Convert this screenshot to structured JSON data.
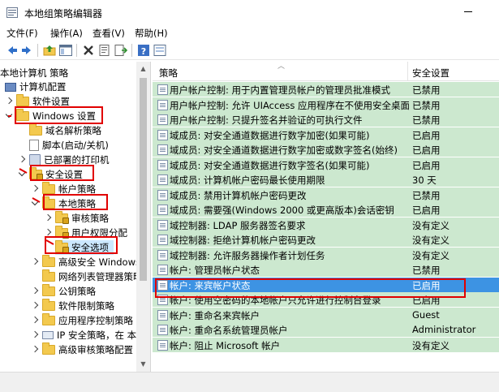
{
  "window": {
    "title": "本地组策略编辑器",
    "icons": {
      "app": "policy-editor-icon",
      "minimize": "minimize-icon"
    }
  },
  "menu": [
    "文件(F)",
    "操作(A)",
    "查看(V)",
    "帮助(H)"
  ],
  "toolbar": {
    "buttons": [
      "back-arrow-icon",
      "forward-arrow-icon",
      "up-folder-icon",
      "show-hide-tree-icon",
      "delete-icon",
      "properties-icon",
      "export-list-icon",
      "help-icon",
      "filter-view-icon"
    ]
  },
  "tree": {
    "root": "本地计算机 策略",
    "items": [
      {
        "label": "计算机配置"
      },
      {
        "label": "软件设置"
      },
      {
        "label": "Windows 设置"
      },
      {
        "label": "域名解析策略"
      },
      {
        "label": "脚本(启动/关机)"
      },
      {
        "label": "已部署的打印机"
      },
      {
        "label": "安全设置"
      },
      {
        "label": "帐户策略"
      },
      {
        "label": "本地策略"
      },
      {
        "label": "审核策略"
      },
      {
        "label": "用户权限分配"
      },
      {
        "label": "安全选项"
      },
      {
        "label": "高级安全 Windows"
      },
      {
        "label": "网络列表管理器策略"
      },
      {
        "label": "公钥策略"
      },
      {
        "label": "软件限制策略"
      },
      {
        "label": "应用程序控制策略"
      },
      {
        "label": "IP 安全策略，在 本"
      },
      {
        "label": "高级审核策略配置"
      }
    ]
  },
  "list": {
    "columns": [
      "策略",
      "安全设置"
    ],
    "rows": [
      {
        "policy": "用户帐户控制: 用于内置管理员帐户的管理员批准模式",
        "setting": "已禁用"
      },
      {
        "policy": "用户帐户控制: 允许 UIAccess 应用程序在不使用安全桌面...",
        "setting": "已禁用"
      },
      {
        "policy": "用户帐户控制: 只提升签名并验证的可执行文件",
        "setting": "已禁用"
      },
      {
        "policy": "域成员: 对安全通道数据进行数字加密(如果可能)",
        "setting": "已启用"
      },
      {
        "policy": "域成员: 对安全通道数据进行数字加密或数字签名(始终)",
        "setting": "已启用"
      },
      {
        "policy": "域成员: 对安全通道数据进行数字签名(如果可能)",
        "setting": "已启用"
      },
      {
        "policy": "域成员: 计算机帐户密码最长使用期限",
        "setting": "30 天"
      },
      {
        "policy": "域成员: 禁用计算机帐户密码更改",
        "setting": "已禁用"
      },
      {
        "policy": "域成员: 需要强(Windows 2000 或更高版本)会话密钥",
        "setting": "已启用"
      },
      {
        "policy": "域控制器: LDAP 服务器签名要求",
        "setting": "没有定义"
      },
      {
        "policy": "域控制器: 拒绝计算机帐户密码更改",
        "setting": "没有定义"
      },
      {
        "policy": "域控制器: 允许服务器操作者计划任务",
        "setting": "没有定义"
      },
      {
        "policy": "帐户: 管理员帐户状态",
        "setting": "已禁用"
      },
      {
        "policy": "帐户: 来宾帐户状态",
        "setting": "已启用"
      },
      {
        "policy": "帐户: 使用空密码的本地帐户只允许进行控制台登录",
        "setting": "已启用"
      },
      {
        "policy": "帐户: 重命名来宾帐户",
        "setting": "Guest"
      },
      {
        "policy": "帐户: 重命名系统管理员帐户",
        "setting": "Administrator"
      },
      {
        "policy": "帐户: 阻止 Microsoft 帐户",
        "setting": "没有定义"
      }
    ]
  },
  "colors": {
    "row_bg": "#cce8cf",
    "selected_row_bg": "#3d93e3",
    "annotation_red": "#e10000"
  }
}
